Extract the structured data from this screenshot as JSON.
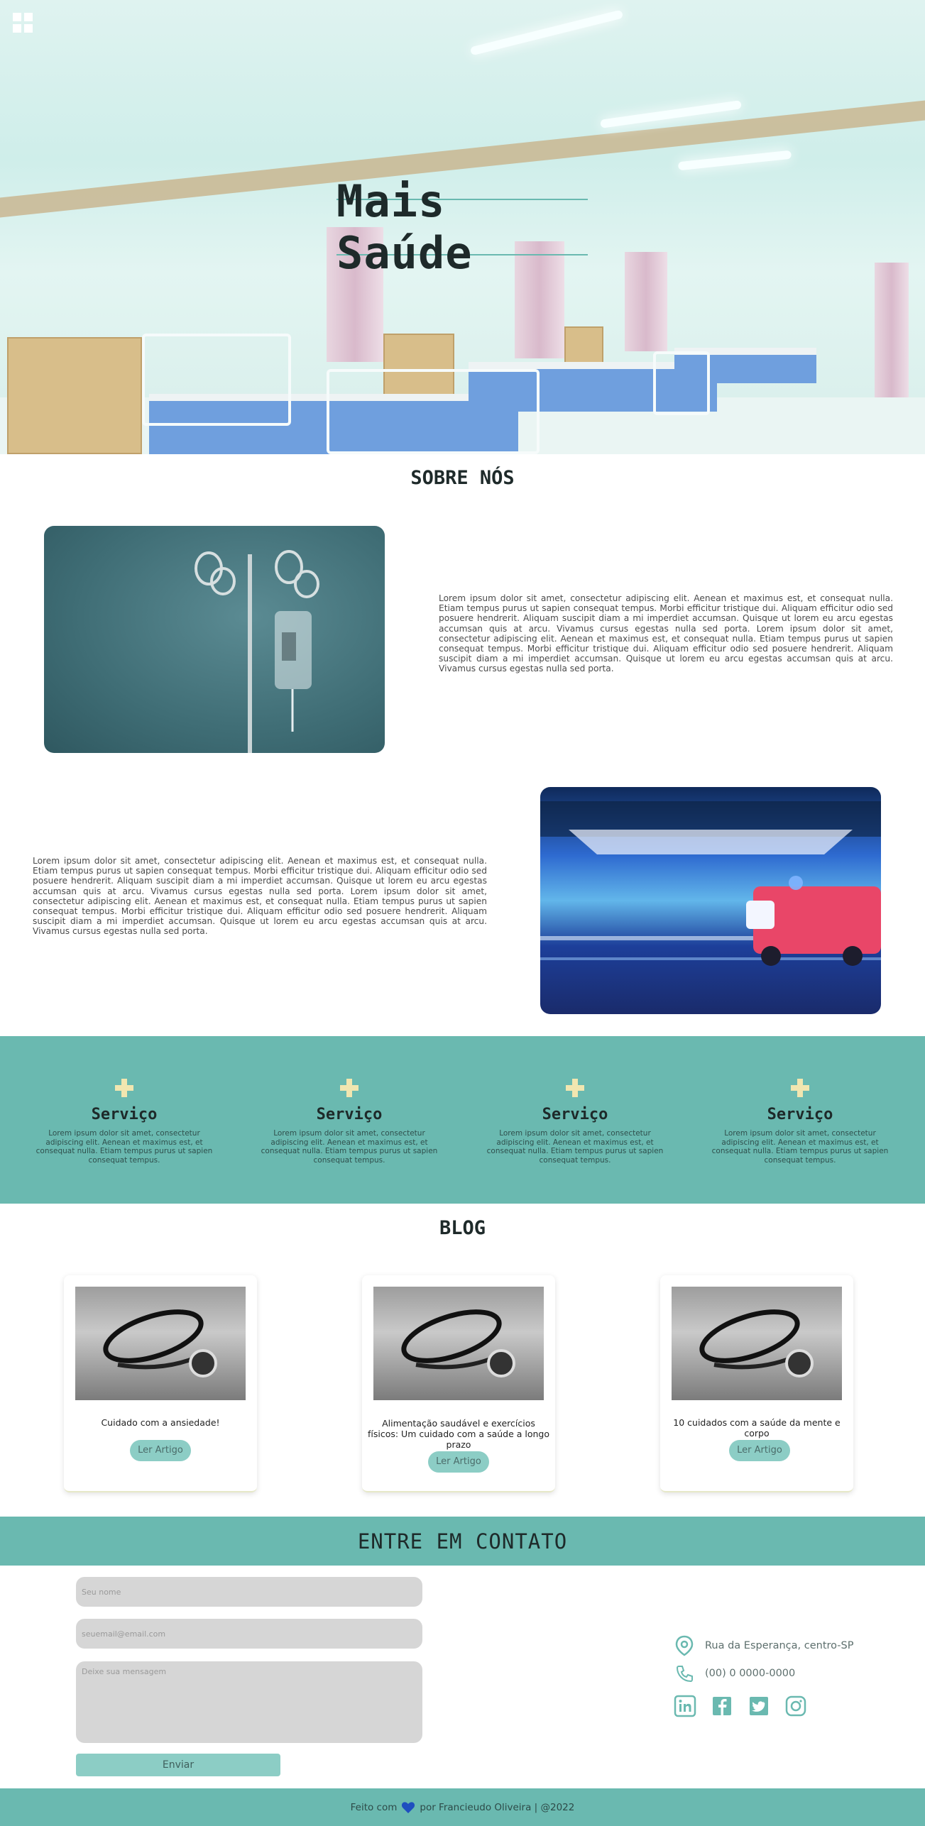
{
  "hero": {
    "title": "Mais Saúde",
    "menu_icon": "grid-icon"
  },
  "about": {
    "title": "SOBRE NÓS",
    "text_1": "Lorem ipsum dolor sit amet, consectetur adipiscing elit. Aenean et maximus est, et consequat nulla. Etiam tempus purus ut sapien consequat tempus. Morbi efficitur tristique dui. Aliquam efficitur odio sed posuere hendrerit. Aliquam suscipit diam a mi imperdiet accumsan. Quisque ut lorem eu arcu egestas accumsan quis at arcu. Vivamus cursus egestas nulla sed porta. Lorem ipsum dolor sit amet, consectetur adipiscing elit. Aenean et maximus est, et consequat nulla. Etiam tempus purus ut sapien consequat tempus. Morbi efficitur tristique dui. Aliquam efficitur odio sed posuere hendrerit. Aliquam suscipit diam a mi imperdiet accumsan. Quisque ut lorem eu arcu egestas accumsan quis at arcu. Vivamus cursus egestas nulla sed porta.",
    "text_2": "Lorem ipsum dolor sit amet, consectetur adipiscing elit. Aenean et maximus est, et consequat nulla. Etiam tempus purus ut sapien consequat tempus. Morbi efficitur tristique dui. Aliquam efficitur odio sed posuere hendrerit. Aliquam suscipit diam a mi imperdiet accumsan. Quisque ut lorem eu arcu egestas accumsan quis at arcu. Vivamus cursus egestas nulla sed porta. Lorem ipsum dolor sit amet, consectetur adipiscing elit. Aenean et maximus est, et consequat nulla. Etiam tempus purus ut sapien consequat tempus. Morbi efficitur tristique dui. Aliquam efficitur odio sed posuere hendrerit. Aliquam suscipit diam a mi imperdiet accumsan. Quisque ut lorem eu arcu egestas accumsan quis at arcu. Vivamus cursus egestas nulla sed porta."
  },
  "services": [
    {
      "icon": "plus-icon",
      "title": "Serviço",
      "text": "Lorem ipsum dolor sit amet, consectetur adipiscing elit. Aenean et maximus est, et consequat nulla. Etiam tempus purus ut sapien consequat tempus."
    },
    {
      "icon": "plus-icon",
      "title": "Serviço",
      "text": "Lorem ipsum dolor sit amet, consectetur adipiscing elit. Aenean et maximus est, et consequat nulla. Etiam tempus purus ut sapien consequat tempus."
    },
    {
      "icon": "plus-icon",
      "title": "Serviço",
      "text": "Lorem ipsum dolor sit amet, consectetur adipiscing elit. Aenean et maximus est, et consequat nulla. Etiam tempus purus ut sapien consequat tempus."
    },
    {
      "icon": "plus-icon",
      "title": "Serviço",
      "text": "Lorem ipsum dolor sit amet, consectetur adipiscing elit. Aenean et maximus est, et consequat nulla. Etiam tempus purus ut sapien consequat tempus."
    }
  ],
  "blog": {
    "title": "BLOG",
    "posts": [
      {
        "caption": "Cuidado com a ansiedade!",
        "button": "Ler Artigo"
      },
      {
        "caption": "Alimentação saudável e exercícios físicos: Um cuidado com a saúde a longo prazo",
        "button": "Ler Artigo"
      },
      {
        "caption": "10 cuidados com a saúde da mente e corpo",
        "button": "Ler Artigo"
      }
    ]
  },
  "contact": {
    "title": "ENTRE EM CONTATO",
    "name_placeholder": "Seu nome",
    "email_placeholder": "seuemail@email.com",
    "message_placeholder": "Deixe sua mensagem",
    "send_label": "Enviar",
    "address": "Rua da Esperança, centro-SP",
    "phone": "(00) 0 0000-0000",
    "socials": [
      "linkedin-icon",
      "facebook-icon",
      "twitter-icon",
      "instagram-icon"
    ]
  },
  "footer": {
    "prefix": "Feito com",
    "suffix": "por Francieudo Oliveira | @2022"
  },
  "colors": {
    "accent": "#6ab9b0",
    "button": "#8ccdc5",
    "plus": "#f1e6b0",
    "heart": "#1f4fbf"
  }
}
